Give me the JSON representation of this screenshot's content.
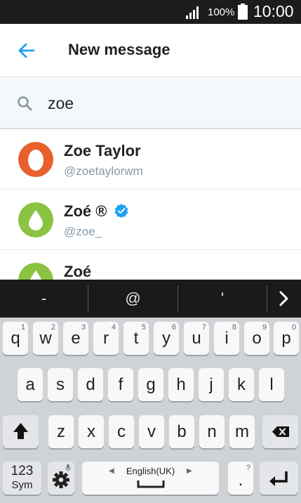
{
  "status_bar": {
    "battery": "100%",
    "time": "10:00",
    "signal_icon": "signal-icon",
    "battery_icon": "battery-icon"
  },
  "header": {
    "title": "New message",
    "back_icon": "arrow-left-icon"
  },
  "search": {
    "value": "zoe",
    "icon": "search-icon"
  },
  "results": [
    {
      "name": "Zoe Taylor",
      "handle": "@zoetaylorwm",
      "verified": false,
      "avatar_color": "#e8602c"
    },
    {
      "name": "Zoé ®",
      "handle": "@zoe_",
      "verified": true,
      "avatar_color": "#8ac340"
    },
    {
      "name": "Zoé",
      "handle": "",
      "verified": false,
      "avatar_color": "#8ac340"
    }
  ],
  "suggestions": [
    "-",
    "@",
    "'"
  ],
  "keyboard": {
    "row1": [
      {
        "k": "q",
        "n": "1"
      },
      {
        "k": "w",
        "n": "2"
      },
      {
        "k": "e",
        "n": "3"
      },
      {
        "k": "r",
        "n": "4"
      },
      {
        "k": "t",
        "n": "5"
      },
      {
        "k": "y",
        "n": "6"
      },
      {
        "k": "u",
        "n": "7"
      },
      {
        "k": "i",
        "n": "8"
      },
      {
        "k": "o",
        "n": "9"
      },
      {
        "k": "p",
        "n": "0"
      }
    ],
    "row2": [
      "a",
      "s",
      "d",
      "f",
      "g",
      "h",
      "j",
      "k",
      "l"
    ],
    "row3": [
      "z",
      "x",
      "c",
      "v",
      "b",
      "n",
      "m"
    ],
    "sym_top": "123",
    "sym_bottom": "Sym",
    "language": "English(UK)",
    "period": ".",
    "period_hint": "?",
    "lang_prev": "◀",
    "lang_next": "▶"
  },
  "colors": {
    "accent": "#1da1f2",
    "verified": "#1da1f2"
  }
}
